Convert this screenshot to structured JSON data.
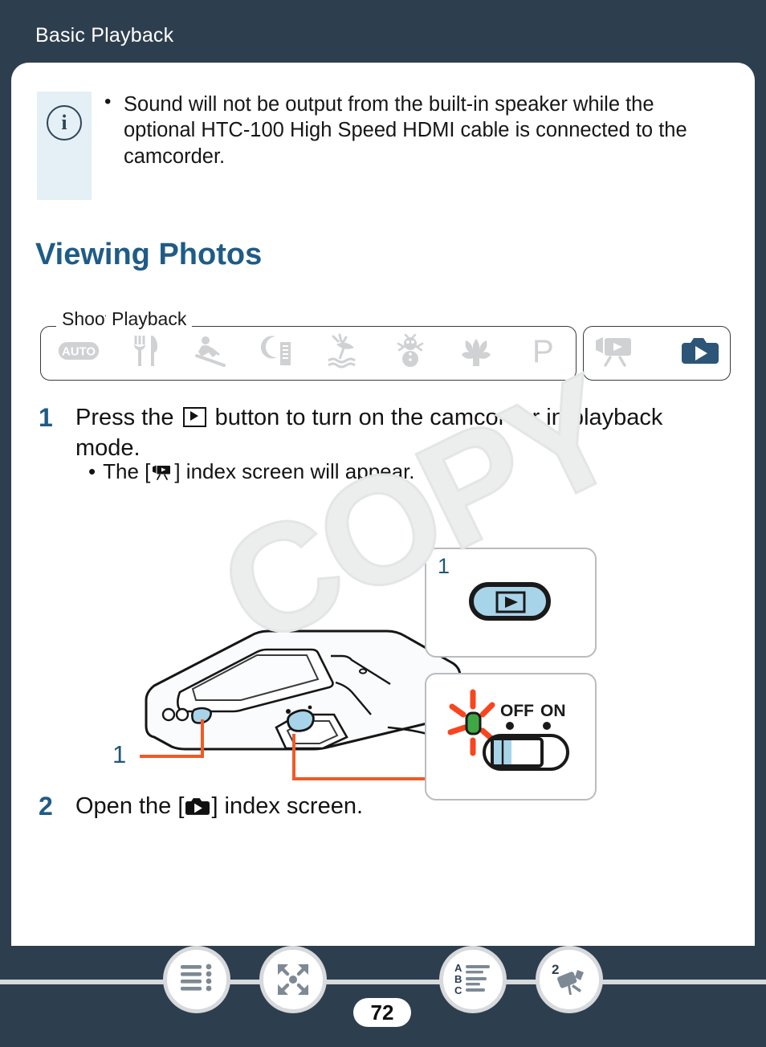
{
  "header": {
    "chapter_title": "Basic Playback",
    "background_color": "#2d3e4f"
  },
  "note": {
    "icon": "info-circle-icon",
    "panel_color": "#e4eff6",
    "text": "Sound will not be output from the built-in speaker while the optional HTC-100 High Speed HDMI cable is connected to the camcorder."
  },
  "section": {
    "heading": "Viewing Photos",
    "heading_color": "#1f5b87"
  },
  "mode_bar": {
    "shooting_label": "Shooting mode",
    "playback_label": "Playback",
    "shooting_modes": [
      {
        "name": "auto-mode-icon",
        "label": "AUTO"
      },
      {
        "name": "food-mode-icon",
        "label": "Food"
      },
      {
        "name": "sports-mode-icon",
        "label": "Sports"
      },
      {
        "name": "night-scene-mode-icon",
        "label": "Night Scene"
      },
      {
        "name": "beach-mode-icon",
        "label": "Beach"
      },
      {
        "name": "snow-mode-icon",
        "label": "Snow"
      },
      {
        "name": "macro-mode-icon",
        "label": "Macro"
      },
      {
        "name": "program-mode-icon",
        "label": "P"
      }
    ],
    "playback_modes": [
      {
        "name": "movie-playback-icon",
        "label": "Movie playback",
        "active": false
      },
      {
        "name": "photo-playback-icon",
        "label": "Photo playback",
        "active": true
      }
    ],
    "active_color": "#2c5578",
    "inactive_color": "#cfd1d3"
  },
  "steps": [
    {
      "number": "1",
      "text_before": "Press the",
      "icon": "play-button-glyph",
      "text_after": "button to turn on the camcorder in playback mode.",
      "substep_before": "The [",
      "substep_icon": "movie-index-glyph",
      "substep_after": "] index screen will appear."
    },
    {
      "number": "2",
      "text_before": "Open the [",
      "icon": "photo-index-glyph",
      "text_after": "] index screen."
    }
  ],
  "illustration": {
    "leader_label": "1",
    "leader_color": "#f05a28",
    "highlight_color": "#a8d4ea",
    "callout1": {
      "number": "1",
      "button_icon": "play-button-icon"
    },
    "callout2": {
      "off_label": "OFF",
      "on_label": "ON",
      "led_color": "#3fa845",
      "flash_color": "#f7461e"
    }
  },
  "watermark": {
    "text": "COPY"
  },
  "footer": {
    "page_number": "72",
    "nav_buttons": [
      {
        "name": "table-of-contents-button"
      },
      {
        "name": "expand-view-button"
      },
      {
        "name": "alphabetical-index-button"
      },
      {
        "name": "camera-section-button",
        "badge": "2"
      }
    ]
  }
}
